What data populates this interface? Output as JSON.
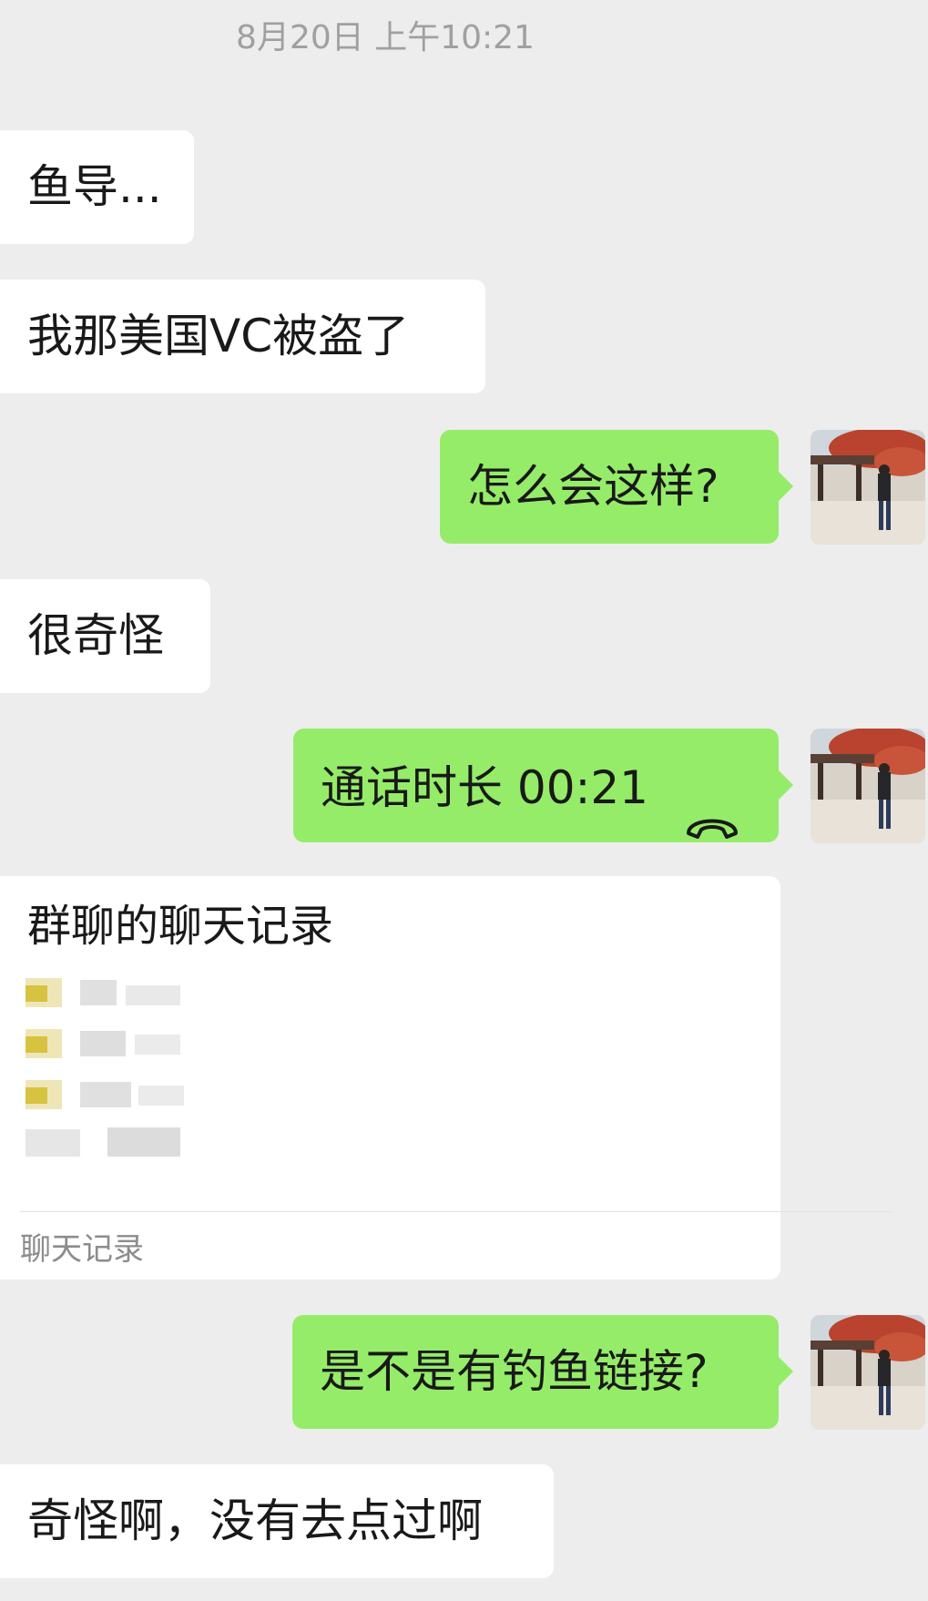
{
  "timestamp": "8月20日 上午10:21",
  "messages": {
    "m1": "鱼导...",
    "m2": "我那美国VC被盗了",
    "m3": "怎么会这样?",
    "m4": "很奇怪",
    "m5": "通话时长 00:21",
    "m6_title": "群聊的聊天记录",
    "m6_footer": "聊天记录",
    "m7": "是不是有钓鱼链接?",
    "m8": "奇怪啊，没有去点过啊"
  },
  "colors": {
    "background": "#ededed",
    "incoming_bubble": "#ffffff",
    "outgoing_bubble": "#95ec69",
    "timestamp_text": "#a0a0a0"
  },
  "icons": {
    "call": "phone-hangup-icon"
  }
}
